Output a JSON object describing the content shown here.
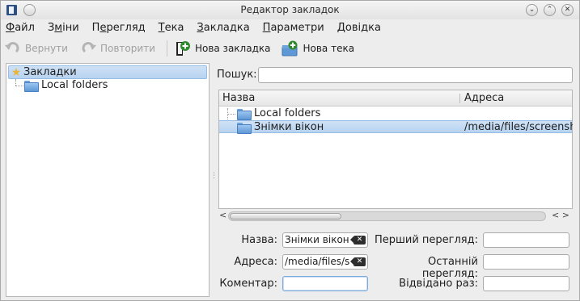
{
  "window": {
    "title": "Редактор закладок",
    "buttons": {
      "minimize": "⌄",
      "maximize": "⌃",
      "close": "✕"
    }
  },
  "menu": {
    "items": [
      {
        "pre": "",
        "key": "Ф",
        "post": "айл"
      },
      {
        "pre": "З",
        "key": "м",
        "post": "іни"
      },
      {
        "pre": "П",
        "key": "е",
        "post": "регляд"
      },
      {
        "pre": "",
        "key": "Т",
        "post": "ека"
      },
      {
        "pre": "",
        "key": "З",
        "post": "акладка"
      },
      {
        "pre": "",
        "key": "П",
        "post": "араметри"
      },
      {
        "pre": "",
        "key": "Д",
        "post": "овідка"
      }
    ]
  },
  "toolbar": {
    "undo_label": "Вернути",
    "redo_label": "Повторити",
    "new_bookmark_label": "Нова закладка",
    "new_folder_label": "Нова тека"
  },
  "tree": {
    "root_label": "Закладки",
    "items": [
      {
        "label": "Local folders"
      }
    ]
  },
  "search": {
    "label": "Пошук:",
    "value": ""
  },
  "list": {
    "headers": {
      "name": "Назва",
      "address": "Адреса"
    },
    "rows": [
      {
        "name": "Local folders",
        "address": ""
      },
      {
        "name": "Знімки вікон",
        "address": "/media/files/screensh"
      }
    ],
    "scroll_left": "<",
    "scroll_right": "< >"
  },
  "form": {
    "name_label": "Назва:",
    "name_value": "Знімки вікон",
    "address_label": "Адреса:",
    "address_value": "/media/files/s",
    "comment_label": "Коментар:",
    "comment_value": "",
    "first_view_label": "Перший перегляд:",
    "first_view_value": "",
    "last_view_label": "Останній перегляд:",
    "last_view_value": "",
    "visits_label": "Відвідано раз:",
    "visits_value": ""
  },
  "colors": {
    "selection": "#b7d3f0",
    "folder": "#5f98d6",
    "accent": "#7aa9dc"
  },
  "icons": {
    "app": "bookmark-editor-icon",
    "undo": "undo-icon",
    "redo": "redo-icon",
    "new_bookmark": "new-bookmark-icon",
    "new_folder": "new-folder-icon",
    "root": "star-icon",
    "folder": "folder-icon",
    "clear": "clear-field-icon"
  }
}
